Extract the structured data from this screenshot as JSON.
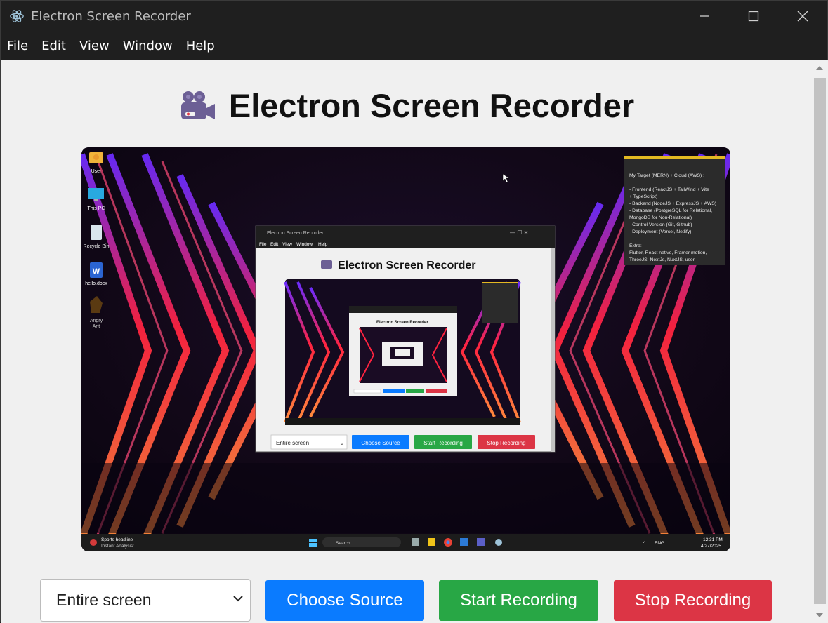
{
  "window": {
    "title": "Electron Screen Recorder",
    "minimize_icon": "minimize-icon",
    "maximize_icon": "maximize-icon",
    "close_icon": "close-icon"
  },
  "menu": [
    "File",
    "Edit",
    "View",
    "Window",
    "Help"
  ],
  "page": {
    "heading": "Electron Screen Recorder",
    "heading_icon": "movie-camera-icon"
  },
  "preview": {
    "desktop_icons": [
      "User",
      "This PC",
      "Recycle Bin",
      "hello.docx",
      "Angry\nAnt"
    ],
    "sticky_note": {
      "title": "My Target (MERN) + Cloud (AWS) :",
      "lines": [
        "- Frontend (ReactJS + TailWind + Vite",
        "+ TypeScript)",
        "- Backend (NodeJS + ExpressJS + AWS)",
        "- Database (PostgreSQL for Relational,",
        "MongoDB for Non-Relational)",
        "- Control Version (Git, Github)",
        "- Deployment (Vercel, Netlify)",
        "",
        "Extra:",
        "Flutter, React native, Framer motion,",
        "ThreeJS, NextJs, NuxtJS, user"
      ]
    },
    "inner_window": {
      "title": "Electron Screen Recorder",
      "menu": [
        "File",
        "Edit",
        "View",
        "Window",
        "Help"
      ],
      "heading": "Electron Screen Recorder",
      "select_value": "Entire screen",
      "buttons": [
        "Choose Source",
        "Start Recording",
        "Stop Recording"
      ]
    },
    "taskbar": {
      "news_title": "Sports headline",
      "news_sub": "Instant Analysis:...",
      "search_placeholder": "Search",
      "lang": "ENG",
      "time": "12:31 PM",
      "date": "4/27/2025"
    }
  },
  "controls": {
    "source_select_value": "Entire screen",
    "choose_source_label": "Choose Source",
    "start_recording_label": "Start Recording",
    "stop_recording_label": "Stop Recording"
  },
  "colors": {
    "primary": "#0a7bff",
    "success": "#28a745",
    "danger": "#dc3545",
    "titlebar": "#1f1f1f",
    "content_bg": "#f0f0f0"
  }
}
